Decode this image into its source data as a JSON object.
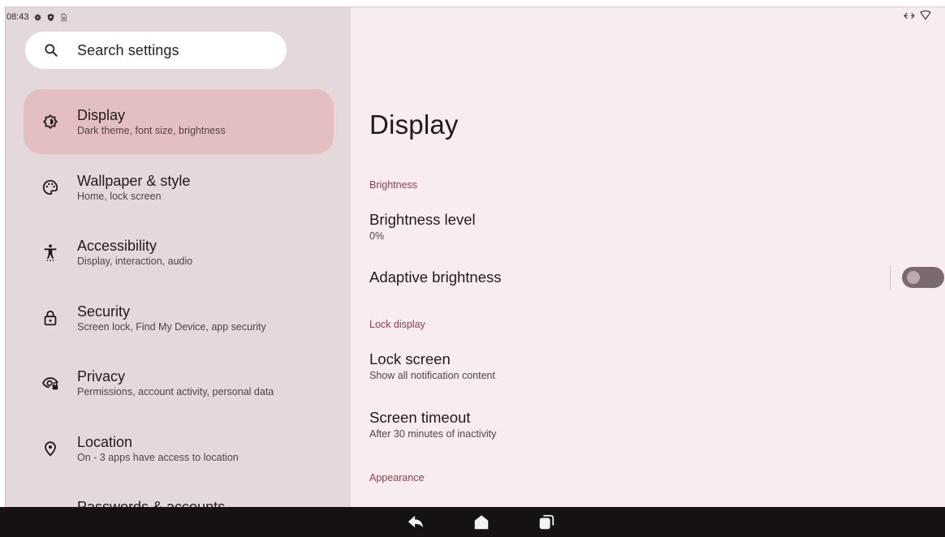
{
  "status_bar": {
    "time": "08:43",
    "left_icons": [
      "settings-gear-icon",
      "shield-icon",
      "sim-card-icon"
    ],
    "right_icons": [
      "data-arrows-icon",
      "wifi-outline-icon"
    ]
  },
  "search": {
    "placeholder": "Search settings",
    "icon": "search-icon"
  },
  "sidebar": {
    "selected_index": 0,
    "items": [
      {
        "title": "Display",
        "summary": "Dark theme, font size, brightness",
        "icon": "display-brightness-icon"
      },
      {
        "title": "Wallpaper & style",
        "summary": "Home, lock screen",
        "icon": "palette-icon"
      },
      {
        "title": "Accessibility",
        "summary": "Display, interaction, audio",
        "icon": "accessibility-icon"
      },
      {
        "title": "Security",
        "summary": "Screen lock, Find My Device, app security",
        "icon": "lock-icon"
      },
      {
        "title": "Privacy",
        "summary": "Permissions, account activity, personal data",
        "icon": "privacy-eye-icon"
      },
      {
        "title": "Location",
        "summary": "On - 3 apps have access to location",
        "icon": "location-pin-icon"
      },
      {
        "title": "Passwords & accounts",
        "summary": "",
        "icon": "accounts-icon"
      }
    ]
  },
  "detail": {
    "title": "Display",
    "sections": {
      "brightness": {
        "header": "Brightness",
        "brightness_level": {
          "title": "Brightness level",
          "summary": "0%"
        },
        "adaptive_brightness": {
          "title": "Adaptive brightness",
          "enabled": false
        }
      },
      "lock_display": {
        "header": "Lock display",
        "lock_screen": {
          "title": "Lock screen",
          "summary": "Show all notification content"
        },
        "screen_timeout": {
          "title": "Screen timeout",
          "summary": "After 30 minutes of inactivity"
        }
      },
      "appearance": {
        "header": "Appearance"
      }
    }
  },
  "navigation_bar": {
    "buttons": [
      "back-icon",
      "home-icon",
      "recents-icon"
    ]
  },
  "colors": {
    "sidebar_bg": "#e5d8da",
    "detail_bg": "#f9ecee",
    "selected_item_bg": "#e4bfc2",
    "section_header": "#8b4250",
    "toggle_track_off": "#7b6a6d",
    "navbar_bg": "#161214"
  }
}
